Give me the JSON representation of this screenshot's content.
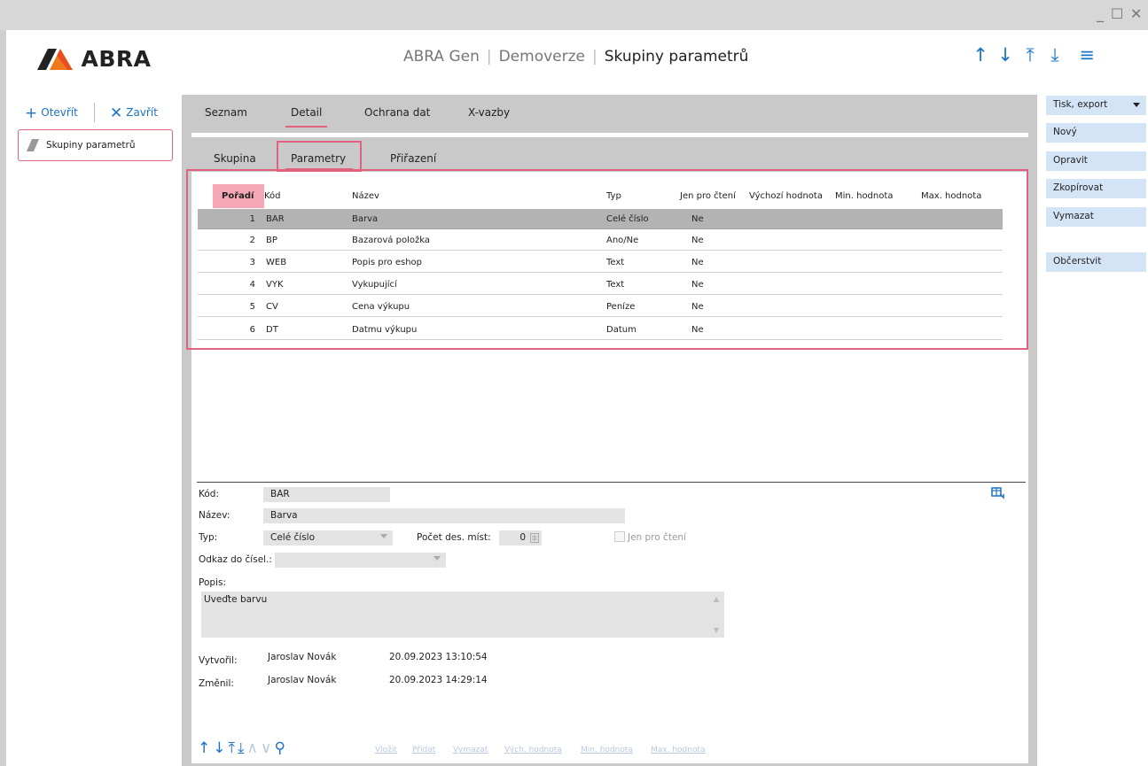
{
  "window": {
    "minimize_icon": "minimize-icon",
    "maximize_icon": "maximize-icon",
    "close_icon": "close-icon",
    "minimize": "_",
    "maximize": "☐",
    "close": "✕"
  },
  "header": {
    "logo_text": "ABRA",
    "app_name": "ABRA Gen",
    "edition": "Demoverze",
    "current": "Skupiny parametrů",
    "separator": "|",
    "nav": {
      "up": "↑",
      "down": "↓",
      "first": "⤒",
      "last": "⤓",
      "menu": "≡"
    }
  },
  "left_panel": {
    "open_icon": "+",
    "open_label": "Otevřít",
    "close_icon": "✕",
    "close_label": "Zavřít",
    "documents": [
      {
        "label": "Skupiny parametrů"
      }
    ]
  },
  "main_tabs": [
    {
      "label": "Seznam",
      "active": false
    },
    {
      "label": "Detail",
      "active": true
    },
    {
      "label": "Ochrana dat",
      "active": false
    },
    {
      "label": "X-vazby",
      "active": false
    }
  ],
  "sub_tabs": [
    {
      "label": "Skupina",
      "active": false
    },
    {
      "label": "Parametry",
      "active": true
    },
    {
      "label": "Přiřazení",
      "active": false
    }
  ],
  "grid": {
    "columns": [
      "Pořadí",
      "Kód",
      "Název",
      "Typ",
      "Jen pro čtení",
      "Výchozí hodnota",
      "Min. hodnota",
      "Max. hodnota"
    ],
    "rows": [
      {
        "poradi": "1",
        "kod": "BAR",
        "nazev": "Barva",
        "typ": "Celé číslo",
        "jen": "Ne",
        "selected": true
      },
      {
        "poradi": "2",
        "kod": "BP",
        "nazev": "Bazarová položka",
        "typ": "Ano/Ne",
        "jen": "Ne"
      },
      {
        "poradi": "3",
        "kod": "WEB",
        "nazev": "Popis pro eshop",
        "typ": "Text",
        "jen": "Ne"
      },
      {
        "poradi": "4",
        "kod": "VYK",
        "nazev": "Vykupující",
        "typ": "Text",
        "jen": "Ne"
      },
      {
        "poradi": "5",
        "kod": "CV",
        "nazev": "Cena výkupu",
        "typ": "Peníze",
        "jen": "Ne"
      },
      {
        "poradi": "6",
        "kod": "DT",
        "nazev": "Datmu výkupu",
        "typ": "Datum",
        "jen": "Ne"
      }
    ]
  },
  "form": {
    "kod_label": "Kód:",
    "kod_value": "BAR",
    "nazev_label": "Název:",
    "nazev_value": "Barva",
    "typ_label": "Typ:",
    "typ_value": "Celé číslo",
    "pocet_label": "Počet des. míst:",
    "pocet_value": "0",
    "jen_label": "Jen pro čtení",
    "odkaz_label": "Odkaz do čísel.:",
    "odkaz_value": "",
    "popis_label": "Popis:",
    "popis_value": "Uveďte barvu",
    "vytvoril_label": "Vytvořil:",
    "vytvoril_user": "Jaroslav Novák",
    "vytvoril_date": "20.09.2023 13:10:54",
    "zmenil_label": "Změnil:",
    "zmenil_user": "Jaroslav Novák",
    "zmenil_date": "20.09.2023 14:29:14"
  },
  "bottom_toolbar": {
    "nav": {
      "up": "↑",
      "down": "↓",
      "first": "⤒",
      "last": "⤓",
      "prev": "∧",
      "next": "∨",
      "search": "⚲"
    },
    "actions": [
      "Vložit",
      "Přidat",
      "Vymazat",
      "Vých. hodnota",
      "Min. hodnota",
      "Max. hodnota"
    ]
  },
  "right_panel": {
    "tisk": "Tisk, export",
    "novy": "Nový",
    "opravit": "Opravit",
    "zkopirovat": "Zkopírovat",
    "vymazat": "Vymazat",
    "obcerstvit": "Občerstvit"
  },
  "colors": {
    "accent": "#e0627e",
    "link": "#1a73c8",
    "button_bg": "#d4e4f7",
    "selected_row": "#b3b3b3"
  }
}
